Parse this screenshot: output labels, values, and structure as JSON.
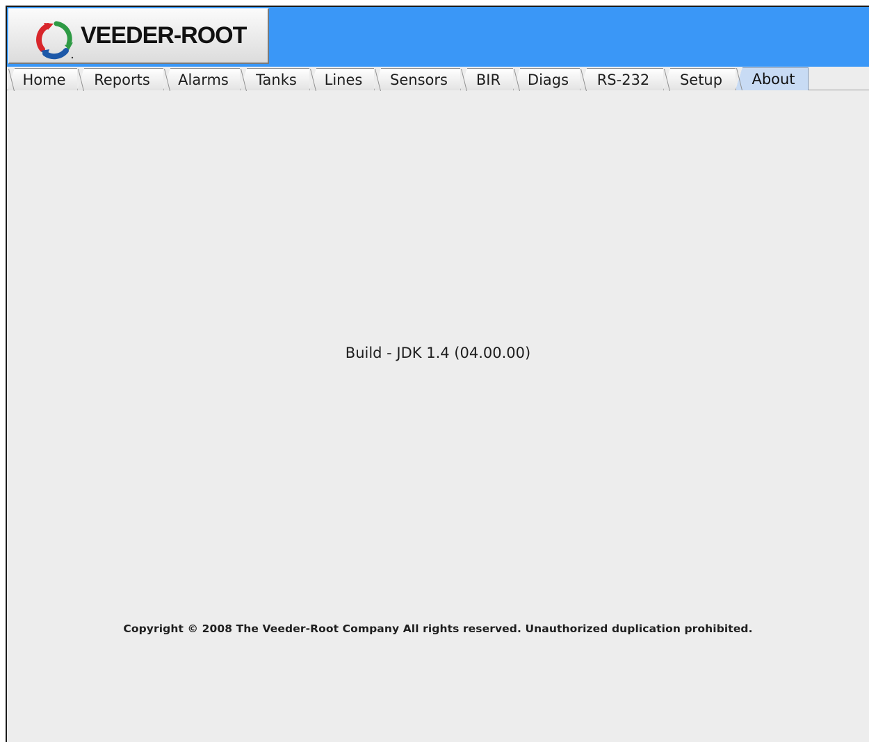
{
  "header": {
    "logo_text": "VEEDER-ROOT",
    "logo_icon": "veeder-root-logo-icon",
    "background_color": "#3a97f7"
  },
  "tabs": [
    {
      "label": "Home",
      "selected": false
    },
    {
      "label": "Reports",
      "selected": false
    },
    {
      "label": "Alarms",
      "selected": false
    },
    {
      "label": "Tanks",
      "selected": false
    },
    {
      "label": "Lines",
      "selected": false
    },
    {
      "label": "Sensors",
      "selected": false
    },
    {
      "label": "BIR",
      "selected": false
    },
    {
      "label": "Diags",
      "selected": false
    },
    {
      "label": "RS-232",
      "selected": false
    },
    {
      "label": "Setup",
      "selected": false
    },
    {
      "label": "About",
      "selected": true
    }
  ],
  "about": {
    "build": "Build - JDK 1.4 (04.00.00)",
    "copyright": "Copyright © 2008 The Veeder-Root Company All rights reserved. Unauthorized duplication prohibited."
  },
  "colors": {
    "selected_tab": "#c8dbf4",
    "panel_background": "#ededed"
  }
}
